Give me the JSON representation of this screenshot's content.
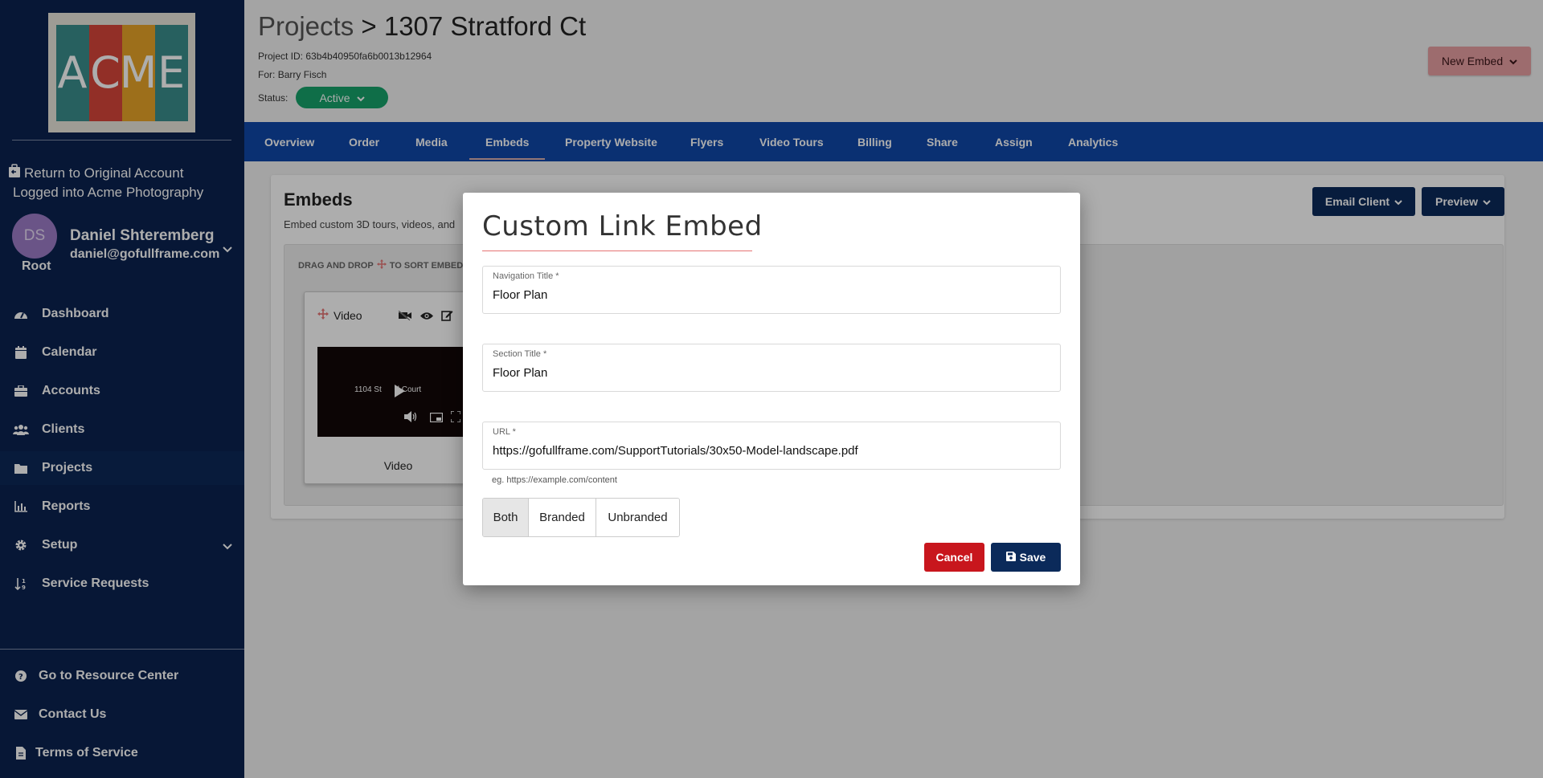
{
  "sidebar": {
    "logo_letters": [
      "A",
      "C",
      "M",
      "E"
    ],
    "logo_colors": [
      "#3a8e8c",
      "#d8463a",
      "#e7a428",
      "#3a8e8c"
    ],
    "return_label": "Return to Original Account",
    "logged_in_label": "Logged into Acme Photography",
    "user": {
      "initials": "DS",
      "name": "Daniel Shteremberg",
      "email": "daniel@gofullframe.com",
      "role": "Root"
    },
    "nav": [
      {
        "label": "Dashboard",
        "icon": "dashboard-icon"
      },
      {
        "label": "Calendar",
        "icon": "calendar-icon"
      },
      {
        "label": "Accounts",
        "icon": "briefcase-icon"
      },
      {
        "label": "Clients",
        "icon": "users-icon"
      },
      {
        "label": "Projects",
        "icon": "folder-icon",
        "active": true
      },
      {
        "label": "Reports",
        "icon": "chart-icon"
      },
      {
        "label": "Setup",
        "icon": "gear-icon"
      },
      {
        "label": "Service Requests",
        "icon": "sort-icon"
      }
    ],
    "footer": [
      {
        "label": "Go to Resource Center",
        "icon": "help-icon"
      },
      {
        "label": "Contact Us",
        "icon": "envelope-icon"
      },
      {
        "label": "Terms of Service",
        "icon": "document-icon"
      }
    ]
  },
  "header": {
    "breadcrumb_root": "Projects",
    "breadcrumb_sep": ">",
    "project_name": "1307 Stratford Ct",
    "project_id_label": "Project ID:",
    "project_id": "63b4b40950fa6b0013b12964",
    "for_label": "For:",
    "for_value": "Barry Fisch",
    "status_label": "Status:",
    "status_value": "Active",
    "new_embed_label": "New Embed"
  },
  "tabs": [
    "Overview",
    "Order",
    "Media",
    "Embeds",
    "Property Website",
    "Flyers",
    "Video Tours",
    "Billing",
    "Share",
    "Assign",
    "Analytics"
  ],
  "active_tab": "Embeds",
  "embeds": {
    "title": "Embeds",
    "subtitle": "Embed custom 3D tours, videos, and",
    "email_client_label": "Email Client",
    "preview_label": "Preview",
    "dropzone_label_pre": "DRAG AND DROP",
    "dropzone_label_post": "TO SORT EMBEDS",
    "video_card": {
      "type_label": "Video",
      "thumb_text": "1104 St",
      "thumb_text_2": "d Court",
      "caption": "Video"
    }
  },
  "modal": {
    "title": "Custom Link Embed",
    "nav_title_label": "Navigation Title *",
    "nav_title_value": "Floor Plan",
    "section_title_label": "Section Title *",
    "section_title_value": "Floor Plan",
    "url_label": "URL *",
    "url_value": "https://gofullframe.com/SupportTutorials/30x50-Model-landscape.pdf",
    "url_hint": "eg. https://example.com/content",
    "segments": [
      "Both",
      "Branded",
      "Unbranded"
    ],
    "active_segment": "Both",
    "cancel_label": "Cancel",
    "save_label": "Save"
  },
  "colors": {
    "sidebar_bg": "#0b2350",
    "tabbar_bg": "#0f47a8",
    "status_green": "#17a36a",
    "cancel_red": "#c8161d",
    "primary_navy": "#0b2a5a"
  }
}
